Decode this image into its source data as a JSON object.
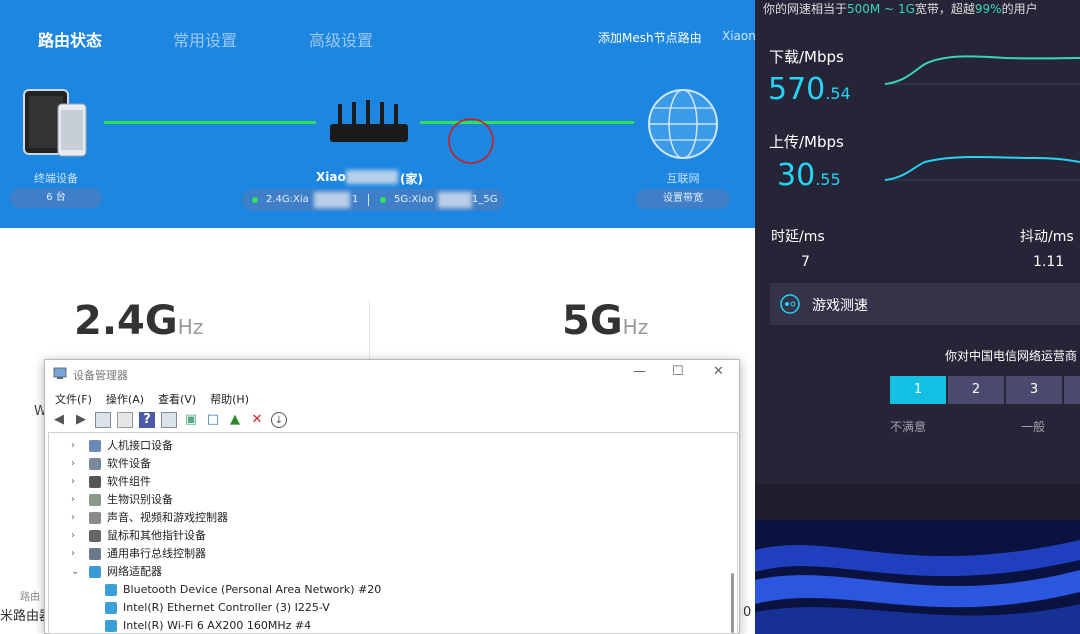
{
  "router": {
    "tabs": [
      {
        "label": "路由状态",
        "active": true
      },
      {
        "label": "常用设置",
        "active": false
      },
      {
        "label": "高级设置",
        "active": false
      }
    ],
    "add_mesh": "添加Mesh节点路由",
    "user": "Xiaon",
    "devices_label": "终端设备",
    "devices_count": "6 台",
    "router_name": "Xiao",
    "router_suffix": "(家)",
    "wifi24": "2.4G:Xia",
    "wifi24_tail": "1",
    "wifi5": "5G:Xiao",
    "wifi5_tail": "1_5G",
    "internet_label": "互联网",
    "bandwidth_button": "设置带宽",
    "freq24": "2.4G",
    "freq5": "5G",
    "freq_unit": "Hz",
    "cut_left": "路由",
    "cut_left2": "米路由器",
    "cut_w": "W",
    "cut_right": "0",
    "colors": {
      "header": "#1d86e0",
      "link": "#2ee05a"
    }
  },
  "device_manager": {
    "title": "设备管理器",
    "window_controls": [
      "—",
      "☐",
      "✕"
    ],
    "menu": [
      "文件(F)",
      "操作(A)",
      "查看(V)",
      "帮助(H)"
    ],
    "toolbar": [
      "back-icon",
      "forward-icon",
      "properties-icon",
      "show-hidden-icon",
      "help-icon",
      "list-icon",
      "update-driver-icon",
      "monitor-icon",
      "enable-icon",
      "remove-icon",
      "download-icon"
    ],
    "tree": [
      {
        "label": "人机接口设备",
        "expanded": false,
        "icon": "hid-icon"
      },
      {
        "label": "软件设备",
        "expanded": false,
        "icon": "software-device-icon"
      },
      {
        "label": "软件组件",
        "expanded": false,
        "icon": "software-component-icon"
      },
      {
        "label": "生物识别设备",
        "expanded": false,
        "icon": "biometric-icon"
      },
      {
        "label": "声音、视频和游戏控制器",
        "expanded": false,
        "icon": "sound-icon"
      },
      {
        "label": "鼠标和其他指针设备",
        "expanded": false,
        "icon": "mouse-icon"
      },
      {
        "label": "通用串行总线控制器",
        "expanded": false,
        "icon": "usb-icon"
      },
      {
        "label": "网络适配器",
        "expanded": true,
        "icon": "network-icon"
      }
    ],
    "adapters": [
      "Bluetooth Device (Personal Area Network) #20",
      "Intel(R) Ethernet Controller (3) I225-V",
      "Intel(R) Wi-Fi 6 AX200 160MHz #4"
    ]
  },
  "speedtest": {
    "top_prefix": "你的网速相当于",
    "top_speed": "500M ~ 1G",
    "top_mid": "宽带，超越",
    "top_percent": "99%",
    "top_suffix": "的用户",
    "download_label": "下载/Mbps",
    "download_int": "570",
    "download_dec": ".54",
    "upload_label": "上传/Mbps",
    "upload_int": "30",
    "upload_dec": ".55",
    "latency_label": "时延/ms",
    "latency_value": "7",
    "jitter_label": "抖动/ms",
    "jitter_value": "1.11",
    "game_label": "游戏测速",
    "rating_question": "你对中国电信网络运营商",
    "rating_buttons": [
      "1",
      "2",
      "3",
      ""
    ],
    "rating_selected": "1",
    "rating_low": "不满意",
    "rating_mid": "一般",
    "colors": {
      "accent": "#25d3f4",
      "bg": "#262537"
    }
  }
}
